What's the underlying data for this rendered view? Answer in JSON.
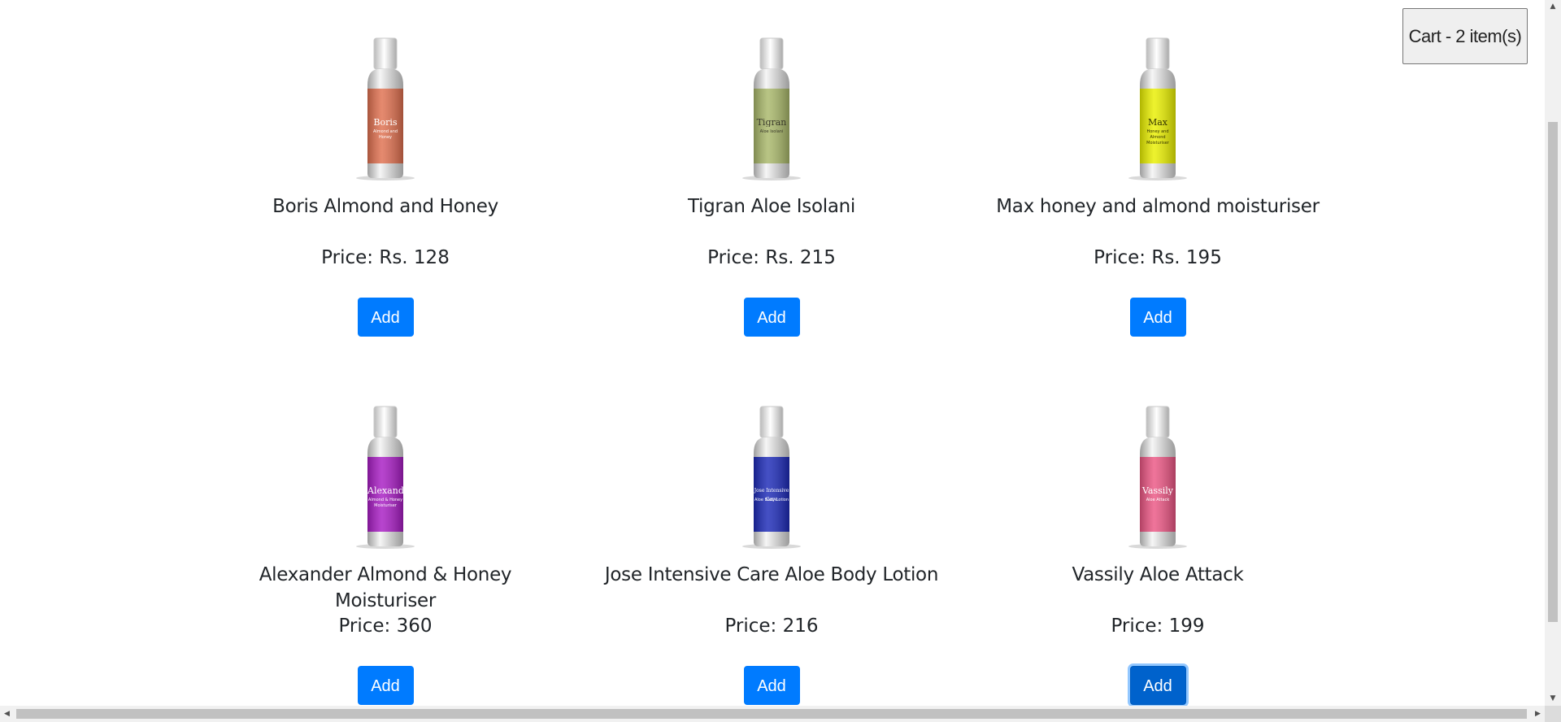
{
  "cart": {
    "label": "Cart - 2 item(s)"
  },
  "products": [
    {
      "name": "Boris Almond and Honey",
      "price": "Price: Rs. 128",
      "add_label": "Add",
      "bottle": {
        "color": "#e0704f",
        "brand": "Boris",
        "sub": "Almond and Honey",
        "text": "#ffffff"
      }
    },
    {
      "name": "Tigran Aloe Isolani",
      "price": "Price: Rs. 215",
      "add_label": "Add",
      "bottle": {
        "color": "#a9b86a",
        "brand": "Tigran",
        "sub": "Aloe Isolani",
        "text": "#3a3a2a"
      }
    },
    {
      "name": "Max honey and almond moisturiser",
      "price": "Price: Rs. 195",
      "add_label": "Add",
      "bottle": {
        "color": "#eaf000",
        "brand": "Max",
        "sub": "Honey and Almond Moisturiser",
        "text": "#333300"
      }
    },
    {
      "name": "Alexander Almond & Honey Moisturiser",
      "price": "Price: 360",
      "add_label": "Add",
      "bottle": {
        "color": "#a81cc4",
        "brand": "Alexander",
        "sub": "Almond & Honey Moisturiser",
        "text": "#ffffff"
      }
    },
    {
      "name": "Jose Intensive Care Aloe Body Lotion",
      "price": "Price: 216",
      "add_label": "Add",
      "bottle": {
        "color": "#1c2ab8",
        "brand": "Jose Intensive Care",
        "sub": "Aloe Body Lotion",
        "text": "#ffffff"
      }
    },
    {
      "name": "Vassily Aloe Attack",
      "price": "Price: 199",
      "add_label": "Add",
      "bottle": {
        "color": "#ec5684",
        "brand": "Vassily",
        "sub": "Aloe Attack",
        "text": "#ffffff"
      }
    }
  ],
  "colors": {
    "primary": "#007bff",
    "primary_focused": "#0062cc"
  },
  "icons": {
    "scroll_up": "triangle-up",
    "scroll_down": "triangle-down",
    "scroll_left": "triangle-left",
    "scroll_right": "triangle-right"
  }
}
